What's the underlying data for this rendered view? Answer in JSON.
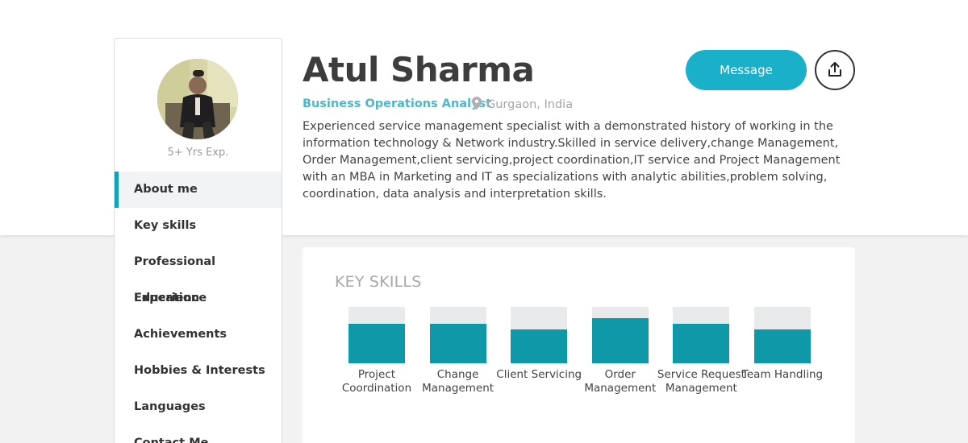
{
  "profile": {
    "name": "Atul Sharma",
    "role": "Business Operations Analyst",
    "location": "Gurgaon, India",
    "experience": "5+ Yrs Exp.",
    "about": "Experienced service management specialist with a demonstrated history of working in the information technology & Network industry.Skilled in service delivery,change Management, Order Management,client servicing,project coordination,IT service and Project Management with an MBA in Marketing and IT as specializations with analytic abilities,problem solving, coordination, data analysis and interpretation skills."
  },
  "actions": {
    "message_label": "Message",
    "share_icon": "share-upload-icon"
  },
  "sidebar": {
    "items": [
      {
        "label": "About me",
        "active": true
      },
      {
        "label": "Key skills",
        "active": false
      },
      {
        "label": "Professional Experience",
        "active": false
      },
      {
        "label": "Education",
        "active": false
      },
      {
        "label": "Achievements",
        "active": false
      },
      {
        "label": "Hobbies & Interests",
        "active": false
      },
      {
        "label": "Languages",
        "active": false
      },
      {
        "label": "Contact Me",
        "active": false
      }
    ]
  },
  "key_skills": {
    "title": "KEY SKILLS",
    "skills": [
      {
        "label": "Project Coordination",
        "level": 0.7
      },
      {
        "label": "Change Management",
        "level": 0.7
      },
      {
        "label": "Client Servicing",
        "level": 0.6
      },
      {
        "label": "Order Management",
        "level": 0.8
      },
      {
        "label": "Service Request Management",
        "level": 0.7
      },
      {
        "label": "Team Handling",
        "level": 0.6
      }
    ]
  },
  "colors": {
    "accent": "#1ab0c9",
    "bar": "#0f98a8",
    "role": "#4fb7c8"
  }
}
